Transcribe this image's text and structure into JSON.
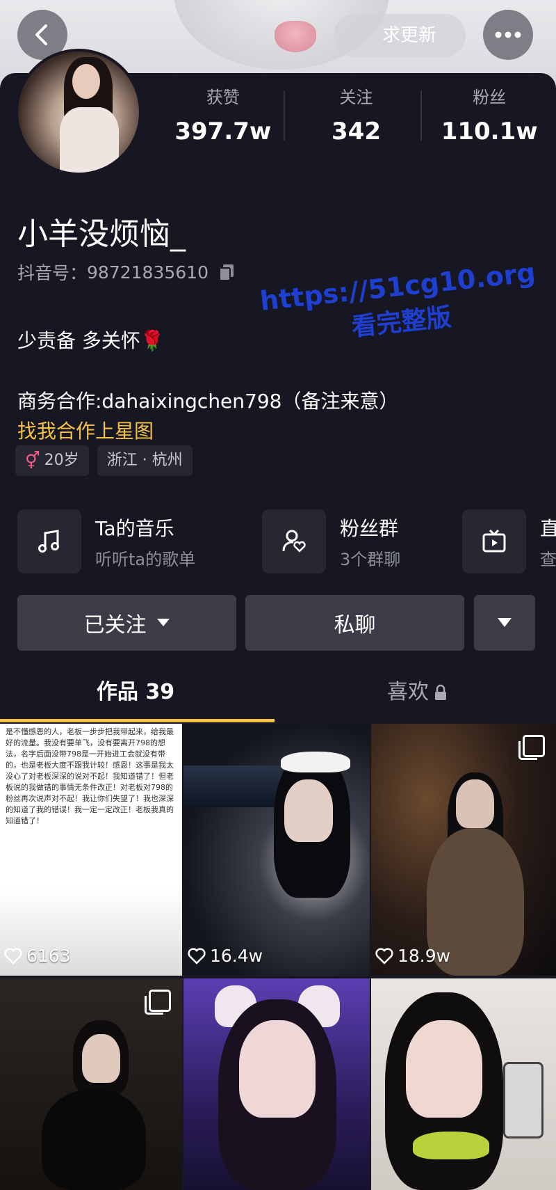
{
  "cover": {
    "pill_text": "求更新"
  },
  "top_bar": {
    "back_icon": "chevron-left-icon",
    "more_icon": "more-dots-icon"
  },
  "stats": [
    {
      "label": "获赞",
      "value": "397.7w"
    },
    {
      "label": "关注",
      "value": "342"
    },
    {
      "label": "粉丝",
      "value": "110.1w"
    }
  ],
  "profile": {
    "nickname": "小羊没烦恼_",
    "account_label": "抖音号：",
    "account_id": "98721835610",
    "signature": "少责备 多关怀🌹",
    "business": "商务合作:dahaixingchen798（备注来意）",
    "star_link": "找我合作上星图",
    "tags": {
      "age": "20岁",
      "location": "浙江 · 杭州"
    }
  },
  "services": [
    {
      "title": "Ta的音乐",
      "sub": "听听ta的歌单",
      "icon": "music-note-icon"
    },
    {
      "title": "粉丝群",
      "sub": "3个群聊",
      "icon": "fan-group-icon"
    },
    {
      "title": "直",
      "sub": "查",
      "icon": "tv-icon"
    }
  ],
  "actions": {
    "follow": "已关注",
    "message": "私聊"
  },
  "tabs": {
    "works": "作品 39",
    "likes": "喜欢"
  },
  "watermark": {
    "url": "https://51cg10.org",
    "sub": "看完整版"
  },
  "videos": [
    {
      "likes": "6163",
      "note": "是不懂感恩的人，老板一步步把我带起来，给我最好的流量。我没有要单飞，没有要离开798的想法，名字后面没带798是一开始进工会就没有带的，也是老板大度不跟我计较！感恩！这事是我太没心了对老板深深的说对不起！我知道错了！但老板说的我做错的事情无条件改正！对老板对798的粉丝再次说声对不起！我让你们失望了！我也深深的知道了我的错误！我一定一定改正！老板我真的知道错了！"
    },
    {
      "likes": "16.4w"
    },
    {
      "likes": "18.9w"
    },
    {},
    {},
    {}
  ],
  "colors": {
    "background": "#161722",
    "accent": "#f3c146",
    "button": "#3b3c48"
  }
}
